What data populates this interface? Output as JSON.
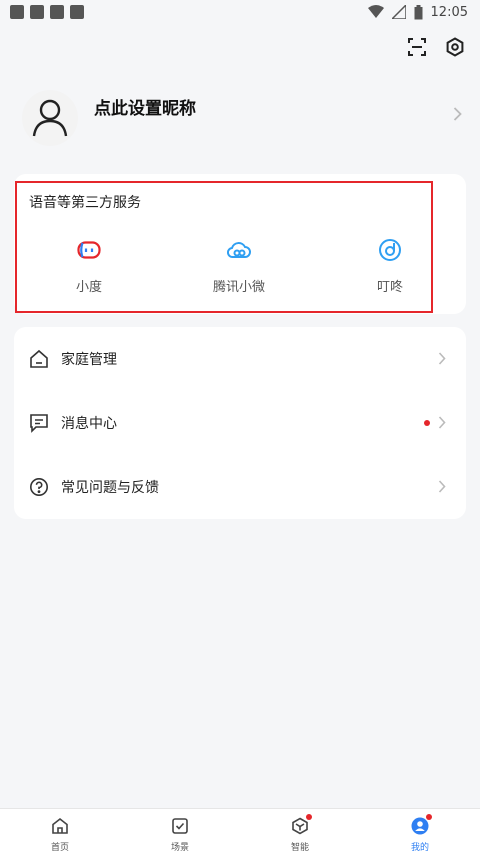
{
  "status_bar": {
    "time": "12:05"
  },
  "profile": {
    "nickname": "点此设置昵称"
  },
  "voice_services": {
    "title": "语音等第三方服务",
    "items": [
      {
        "label": "小度",
        "icon": "xiaodu-icon"
      },
      {
        "label": "腾讯小微",
        "icon": "cloud-icon"
      },
      {
        "label": "叮咚",
        "icon": "dingdong-icon"
      }
    ]
  },
  "menu": {
    "items": [
      {
        "label": "家庭管理",
        "icon": "home-icon"
      },
      {
        "label": "消息中心",
        "icon": "message-icon",
        "badge": true
      },
      {
        "label": "常见问题与反馈",
        "icon": "help-icon"
      }
    ]
  },
  "bottom_nav": {
    "items": [
      {
        "label": "首页",
        "icon": "home-icon"
      },
      {
        "label": "场景",
        "icon": "check-square-icon"
      },
      {
        "label": "智能",
        "icon": "cube-icon",
        "badge": true
      },
      {
        "label": "我的",
        "icon": "profile-icon",
        "active": true,
        "badge": true
      }
    ]
  },
  "colors": {
    "accent": "#2f7ff2",
    "highlight_border": "#e5262b",
    "badge": "#e5262b"
  }
}
